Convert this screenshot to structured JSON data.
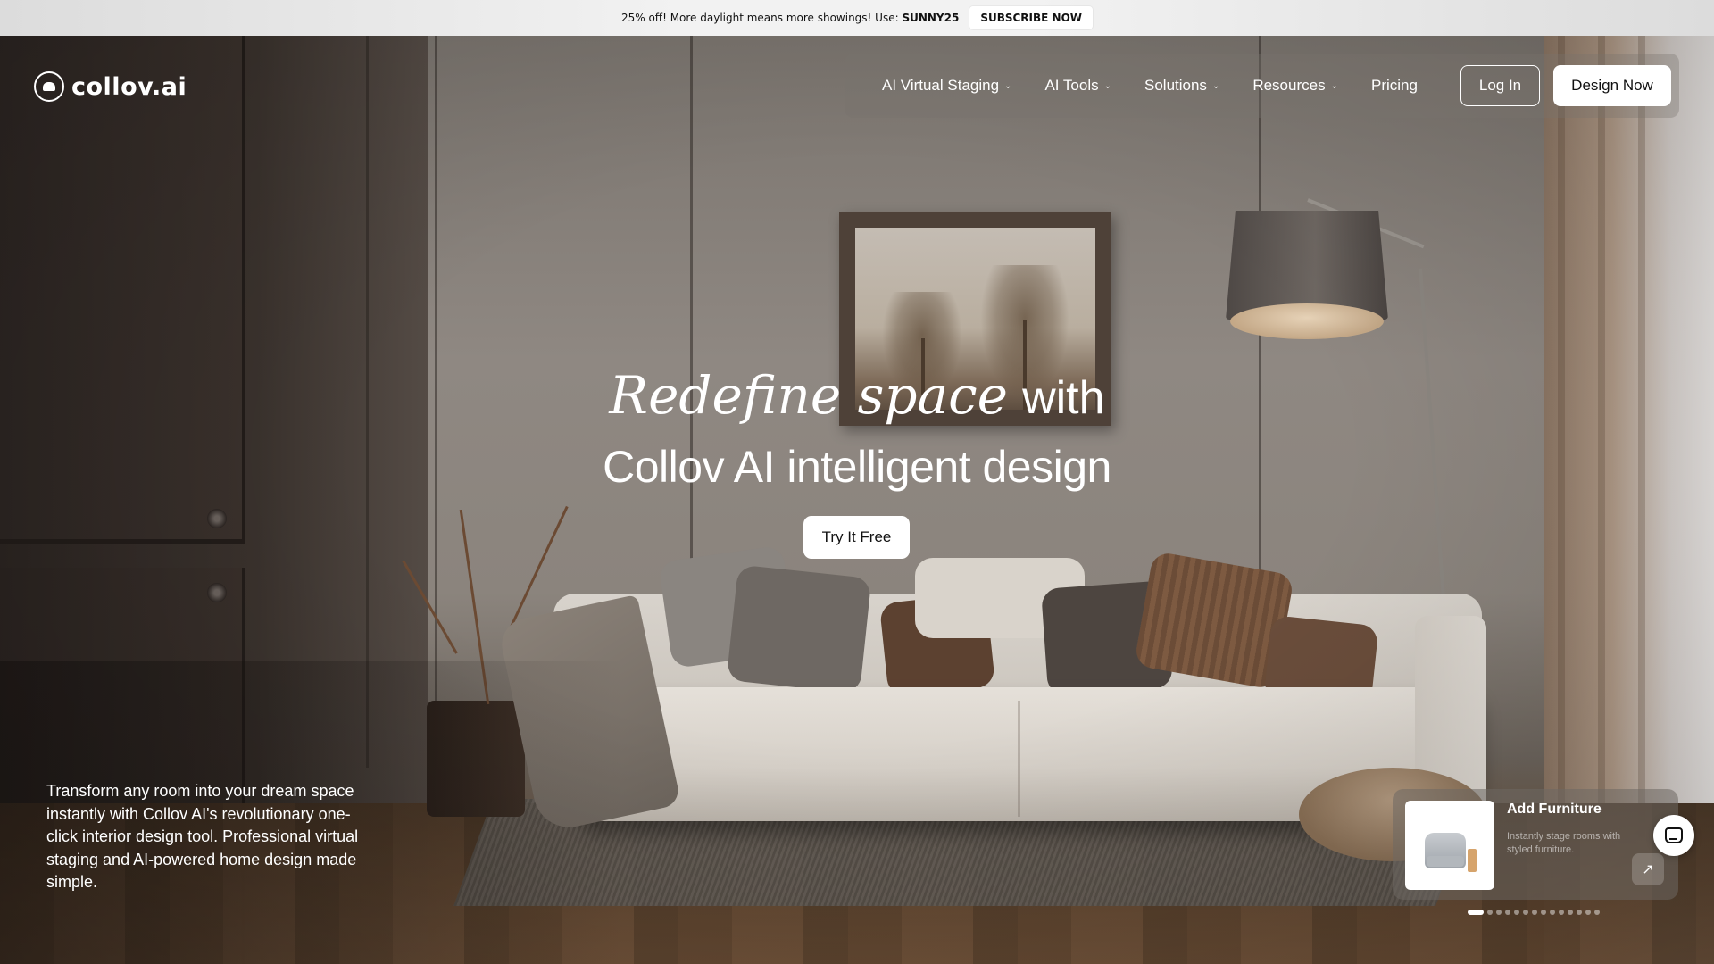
{
  "promo": {
    "text": "25% off! More daylight means more showings! Use: ",
    "code": "SUNNY25",
    "button": "SUBSCRIBE NOW"
  },
  "header": {
    "logo_text": "collov.ai",
    "logo_icon": "collov-logo-icon",
    "nav": [
      {
        "label": "AI Virtual Staging",
        "has_dropdown": true
      },
      {
        "label": "AI Tools",
        "has_dropdown": true
      },
      {
        "label": "Solutions",
        "has_dropdown": true
      },
      {
        "label": "Resources",
        "has_dropdown": true
      },
      {
        "label": "Pricing",
        "has_dropdown": false
      }
    ],
    "login": "Log In",
    "design_now": "Design Now"
  },
  "hero": {
    "headline_italic": "Redefine space",
    "headline_with": "with",
    "headline_line2": "Collov AI intelligent design",
    "cta": "Try It Free",
    "blurb": "Transform any room into your dream space instantly with Collov AI's revolutionary one-click interior design tool. Professional virtual staging and AI-powered home design made simple."
  },
  "feature_card": {
    "title": "Add Furniture",
    "subtitle": "Instantly stage rooms with styled furniture.",
    "arrow_icon": "arrow-up-right-icon",
    "thumbnail_icon": "armchair-icon"
  },
  "chat": {
    "icon": "chat-icon"
  },
  "carousel": {
    "total": 14,
    "active": 0
  }
}
